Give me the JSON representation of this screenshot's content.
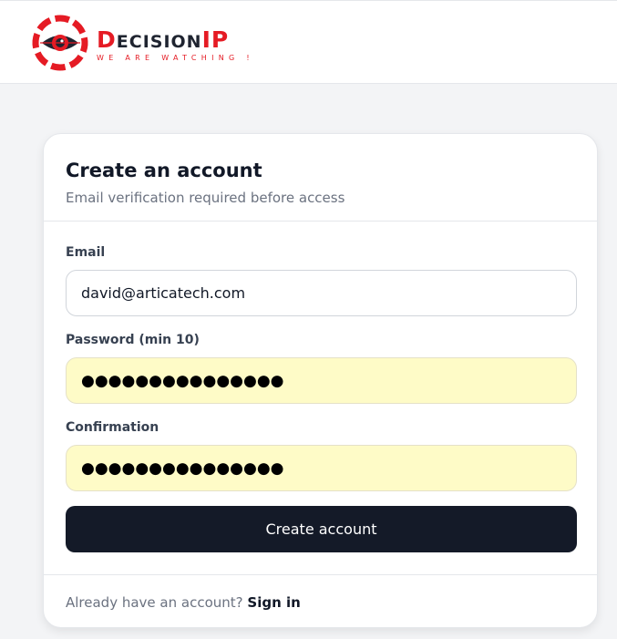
{
  "header": {
    "logo": {
      "brand_first_letter": "D",
      "brand_middle": "ECISION",
      "brand_suffix": "IP",
      "tagline": "WE ARE WATCHING !",
      "brand_red": "#e51b24",
      "brand_dark": "#1f2430"
    }
  },
  "card": {
    "title": "Create an account",
    "subtitle": "Email verification required before access",
    "fields": {
      "email": {
        "label": "Email",
        "value": "david@articatech.com"
      },
      "password": {
        "label": "Password (min 10)",
        "value": "●●●●●●●●●●●●●●●"
      },
      "confirmation": {
        "label": "Confirmation",
        "value": "●●●●●●●●●●●●●●●"
      }
    },
    "submit_label": "Create account",
    "footer": {
      "prompt": "Already have an account?",
      "link_label": "Sign in"
    }
  },
  "colors": {
    "page_bg": "#f3f4f6",
    "button_bg": "#141a28",
    "autofill_bg": "#fefbc7"
  }
}
